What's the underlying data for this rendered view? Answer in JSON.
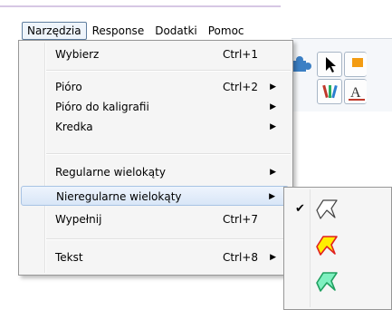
{
  "menubar": [
    {
      "label": "Narzędzia",
      "active": true
    },
    {
      "label": "Response"
    },
    {
      "label": "Dodatki"
    },
    {
      "label": "Pomoc"
    }
  ],
  "menu": {
    "wybierz": {
      "label": "Wybierz",
      "shortcut": "Ctrl+1"
    },
    "pioro": {
      "label": "Pióro",
      "shortcut": "Ctrl+2"
    },
    "pioro_kaligrafii": {
      "label": "Pióro do kaligrafii"
    },
    "kredka": {
      "label": "Kredka"
    },
    "regularne": {
      "label": "Regularne wielokąty"
    },
    "nieregularne": {
      "label": "Nieregularne wielokąty"
    },
    "wypelnij": {
      "label": "Wypełnij",
      "shortcut": "Ctrl+7"
    },
    "tekst": {
      "label": "Tekst",
      "shortcut": "Ctrl+8"
    }
  },
  "submenu": {
    "items": [
      {
        "icon": "white-polygon-icon",
        "fill": "#ffffff",
        "stroke": "#444444",
        "checked": true
      },
      {
        "icon": "yellow-polygon-icon",
        "fill": "#ffee00",
        "stroke": "#e02020",
        "checked": false
      },
      {
        "icon": "green-polygon-icon",
        "fill": "#7ff0c0",
        "stroke": "#20a060",
        "checked": false
      }
    ]
  },
  "icons": {
    "check": "✔",
    "submenu_arrow": "▶"
  }
}
